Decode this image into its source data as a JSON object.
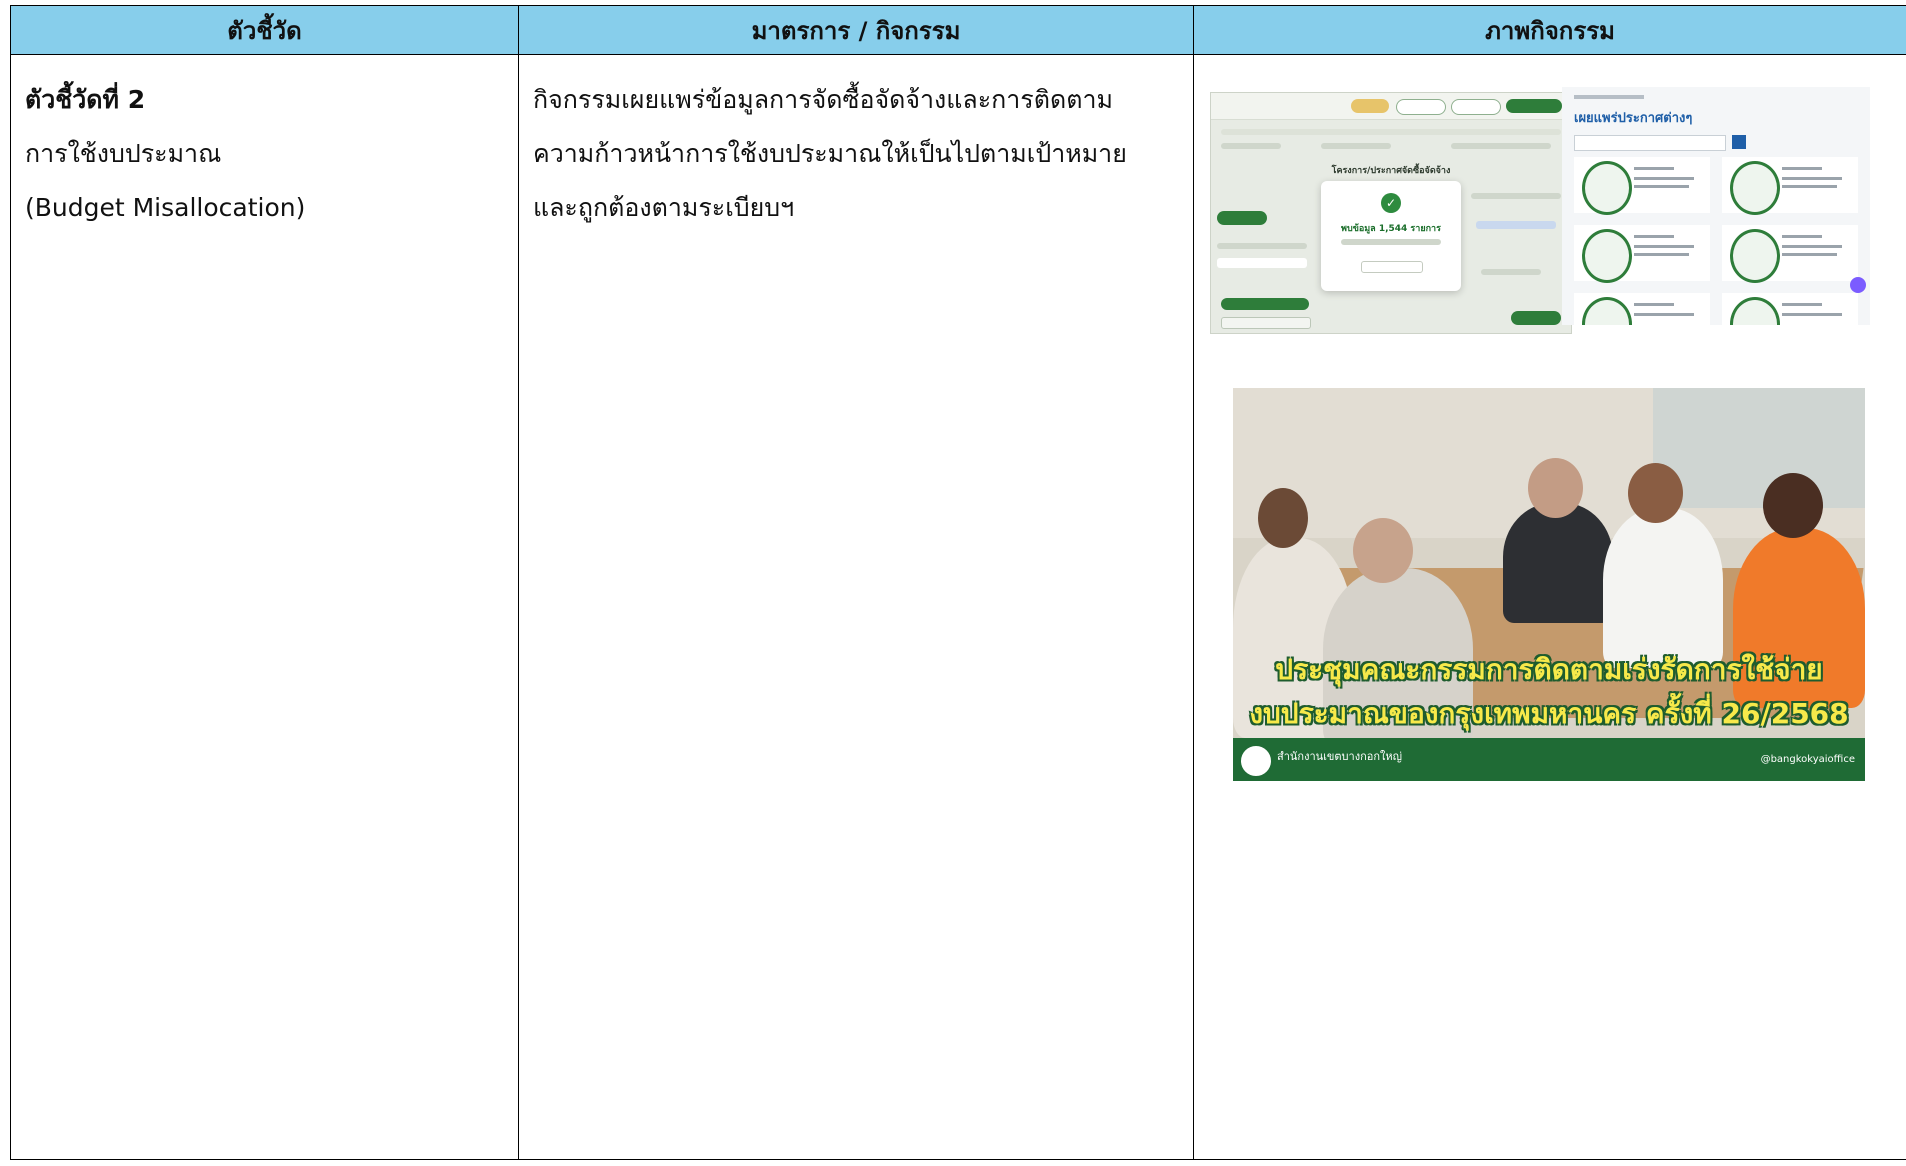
{
  "table": {
    "headers": [
      "ตัวชี้วัด",
      "มาตรการ / กิจกรรม",
      "ภาพกิจกรรม"
    ],
    "row": {
      "indicator_title": "ตัวชี้วัดที่ 2",
      "indicator_line1": "การใช้งบประมาณ",
      "indicator_line2": "(Budget Misallocation)",
      "activity_line1": "กิจกรรมเผยแพร่ข้อมูลการจัดซื้อจัดจ้างและการติดตาม",
      "activity_line2": "ความก้าวหน้าการใช้งบประมาณให้เป็นไปตามเป้าหมาย",
      "activity_line3": "และถูกต้องตามระเบียบฯ"
    }
  },
  "images": {
    "shot1": {
      "modal_title": "พบข้อมูล 1,544 รายการ",
      "page_title": "โครงการ/ประกาศจัดซื้อจัดจ้าง"
    },
    "shot2": {
      "heading": "เผยแพร่ประกาศต่างๆ"
    },
    "photo": {
      "caption_line1": "ประชุมคณะกรรมการติดตามเร่งรัดการใช้จ่าย",
      "caption_line2": "งบประมาณของกรุงเทพมหานคร ครั้งที่ 26/2568",
      "footer_org": "สำนักงานเขตบางกอกใหญ่",
      "footer_social": "@bangkokyaioffice"
    }
  },
  "colors": {
    "header_bg": "#87CEEB",
    "green": "#1f6b35"
  }
}
